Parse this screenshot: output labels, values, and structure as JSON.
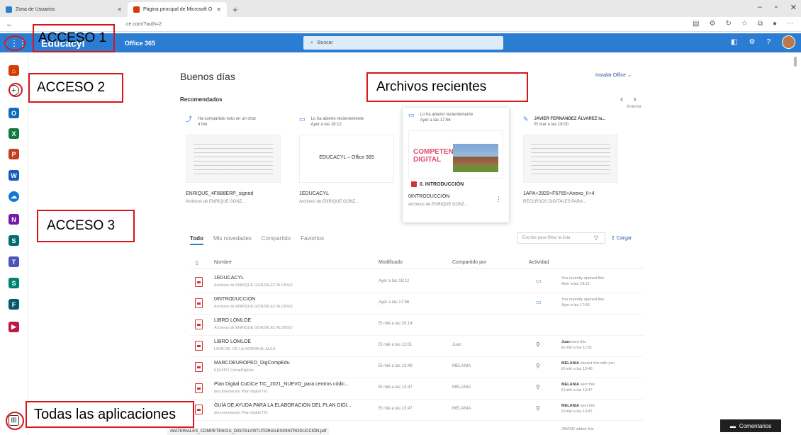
{
  "browser": {
    "tabs": [
      {
        "label": "Zona de Usuarios",
        "active": false,
        "icon_color": "#2b7cd3"
      },
      {
        "label": "Página principal de Microsoft O",
        "active": true,
        "icon_color": "#d83b01"
      }
    ],
    "new_tab": "+",
    "url": "ce.com/?auth=2",
    "window_controls": [
      "–",
      "▫",
      "✕"
    ],
    "status_url": "/MATERIALES_COMPETENCIA_DIGITAL/00TUTORIALES/0INTRODUCCIÓN.pdf"
  },
  "header": {
    "brand": "Educacyl",
    "app_name": "Office 365",
    "search_placeholder": "Buscar",
    "accent_color": "#2b7cd3"
  },
  "rail": {
    "items": [
      {
        "name": "home",
        "color": "#d83b01"
      },
      {
        "name": "create",
        "color": "#333333"
      },
      {
        "name": "outlook",
        "color": "#0f6cbd"
      },
      {
        "name": "excel",
        "color": "#107c41"
      },
      {
        "name": "powerpoint",
        "color": "#c43e1c"
      },
      {
        "name": "word",
        "color": "#185abc"
      },
      {
        "name": "onedrive",
        "color": "#0f78d4"
      },
      {
        "name": "onenote",
        "color": "#7719aa"
      },
      {
        "name": "sharepoint",
        "color": "#036c70"
      },
      {
        "name": "teams",
        "color": "#4b53bc"
      },
      {
        "name": "sway",
        "color": "#008272"
      },
      {
        "name": "forms",
        "color": "#035c67"
      },
      {
        "name": "stream",
        "color": "#bc1948"
      }
    ],
    "all_apps_icon": "⊞"
  },
  "main": {
    "greeting": "Buenos días",
    "install_office": "Instalar Office",
    "recommended_title": "Recomendados",
    "nav_previous": "Anterior",
    "cards": [
      {
        "activity": "Ha compartido esto en un chat",
        "when": "4 feb",
        "name": "ENRIQUE_4F8B8ERP_signed",
        "location": "Archivos de ENRIQUE GONZ...",
        "preview": "doc"
      },
      {
        "activity": "Lo ha abierto recientemente",
        "when": "Ayer a las 18:12",
        "name": "1EDUCACYL",
        "location": "Archivos de ENRIQUE GONZ...",
        "preview": "text",
        "preview_text": "EDUCACYL – Office 365"
      },
      {
        "activity": "Lo ha abierto recientemente",
        "when": "Ayer a las 17:56",
        "name": "0INTRODUCCIÓN",
        "location": "Archivos de ENRIQUE GONZ...",
        "preview": "digital",
        "preview_text": "COMPETENCIA DIGITAL",
        "preview_caption": "0. INTRODUCCIÓN"
      },
      {
        "activity": "JAVIER FERNÁNDEZ ÁLVAREZ la...",
        "when": "El mar a las 16:00",
        "name": "1APA+2829+F5765+Anexo_II+4",
        "location": "RECURSOS DIGITALES PARA...",
        "preview": "doc"
      }
    ],
    "tabs": [
      "Todo",
      "Mis novedades",
      "Compartido",
      "Favoritos"
    ],
    "filter_placeholder": "Escribe para filtrar la lista",
    "upload": "Cargar",
    "columns": {
      "name": "Nombre",
      "modified": "Modificado",
      "shared_by": "Compartido por",
      "activity": "Actividad"
    },
    "files": [
      {
        "name": "1EDUCACYL",
        "location": "Archivos de ENRIQUE GONZÁLEZ ALONSO",
        "modified": "Ayer a las 18:12",
        "shared_by": "",
        "activity_user": "",
        "activity_text": "You recently opened this",
        "activity_when": "Ayer a las 18:12"
      },
      {
        "name": "0INTRODUCCIÓN",
        "location": "Archivos de ENRIQUE GONZÁLEZ ALONSO",
        "modified": "Ayer a las 17:56",
        "shared_by": "",
        "activity_user": "",
        "activity_text": "You recently opened this",
        "activity_when": "Ayer a las 17:56"
      },
      {
        "name": "LIBRO LOMLOE",
        "location": "Archivos de ENRIQUE GONZÁLEZ ALONSO",
        "modified": "El mié a las 20:14",
        "shared_by": "",
        "activity_user": "",
        "activity_text": "",
        "activity_when": ""
      },
      {
        "name": "LIBRO LOMLOE",
        "location": "LOMLOE. DE LA NORMA AL AULA",
        "modified": "El mié a las 11:01",
        "shared_by": "Juan",
        "activity_user": "Juan",
        "activity_text": "sent this",
        "activity_when": "El mié a las 11:01"
      },
      {
        "name": "MARCOEUROPEO_DigCompEdu",
        "location": "EQUIPO CompDigEdu",
        "modified": "El mié a las 13:49",
        "shared_by": "MELANIA",
        "activity_user": "MELANIA",
        "activity_text": "shared this with you",
        "activity_when": "El mié a las 13:49"
      },
      {
        "name": "Plan Digital CoDiCe TIC_2021_NUEVO_para centros códic...",
        "location": "documentación Plan digital TIC",
        "modified": "El mié a las 13:47",
        "shared_by": "MELANIA",
        "activity_user": "MELANIA",
        "activity_text": "sent this",
        "activity_when": "El mié a las 13:47"
      },
      {
        "name": "GUÍA DE AYUDA PARA LA ELABORACIÓN DEL PLAN DIGI...",
        "location": "documentación Plan digital TIC",
        "modified": "El mié a las 13:47",
        "shared_by": "MELANIA",
        "activity_user": "MELANIA",
        "activity_text": "sent this",
        "activity_when": "El mié a las 13:47"
      }
    ],
    "last_row_activity": "JAVIER edited this",
    "comments_button": "Comentarios"
  },
  "annotations": {
    "acceso1": "ACCESO 1",
    "acceso2": "ACCESO 2",
    "acceso3": "ACCESO 3",
    "archivos_recientes": "Archivos recientes",
    "todas_apps": "Todas las aplicaciones",
    "color": "#d9141b"
  }
}
